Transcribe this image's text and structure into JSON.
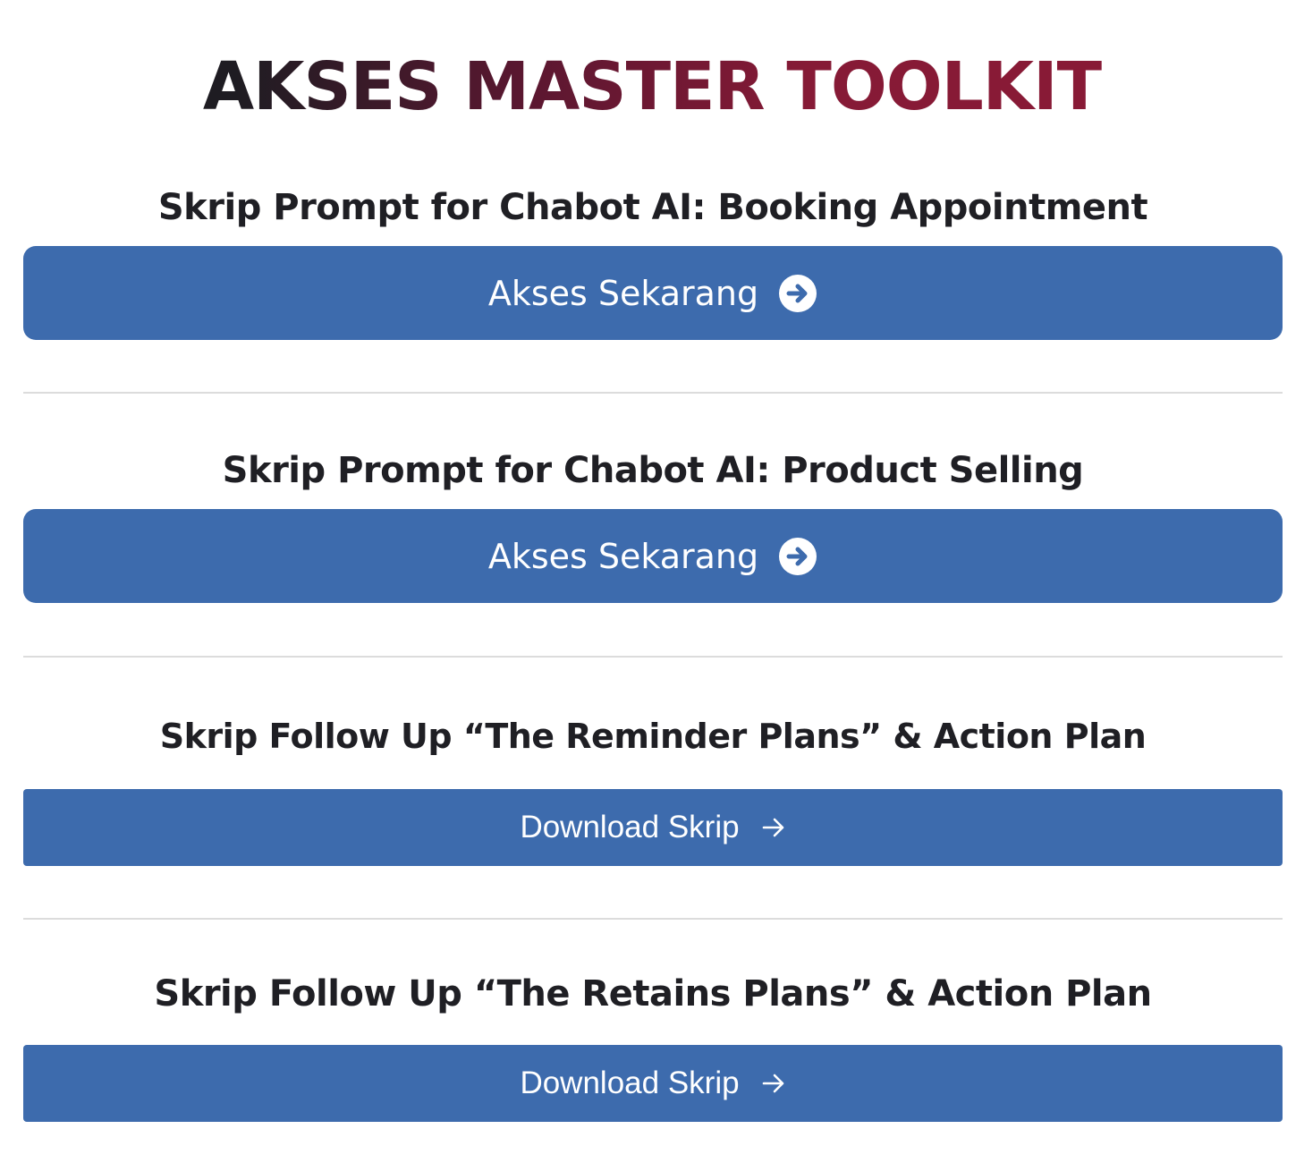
{
  "header": {
    "title_part1": "AKSES ",
    "title_part2": "MASTER TOOLKIT"
  },
  "sections": [
    {
      "heading": "Skrip Prompt for Chabot AI: Booking Appointment",
      "button_label": "Akses Sekarang",
      "button_icon": "arrow-circle-right-icon"
    },
    {
      "heading": "Skrip Prompt for Chabot AI: Product Selling",
      "button_label": "Akses Sekarang",
      "button_icon": "arrow-circle-right-icon"
    },
    {
      "heading": "Skrip Follow Up “The Reminder Plans” & Action Plan",
      "button_label": "Download Skrip",
      "button_icon": "arrow-right-icon"
    },
    {
      "heading": "Skrip Follow Up “The Retains Plans” & Action Plan",
      "button_label": "Download Skrip",
      "button_icon": "arrow-right-icon"
    }
  ],
  "colors": {
    "button_bg": "#3d6bad",
    "title_dark": "#1e1c22",
    "title_accent": "#861a36",
    "divider": "#dcdcdc"
  }
}
